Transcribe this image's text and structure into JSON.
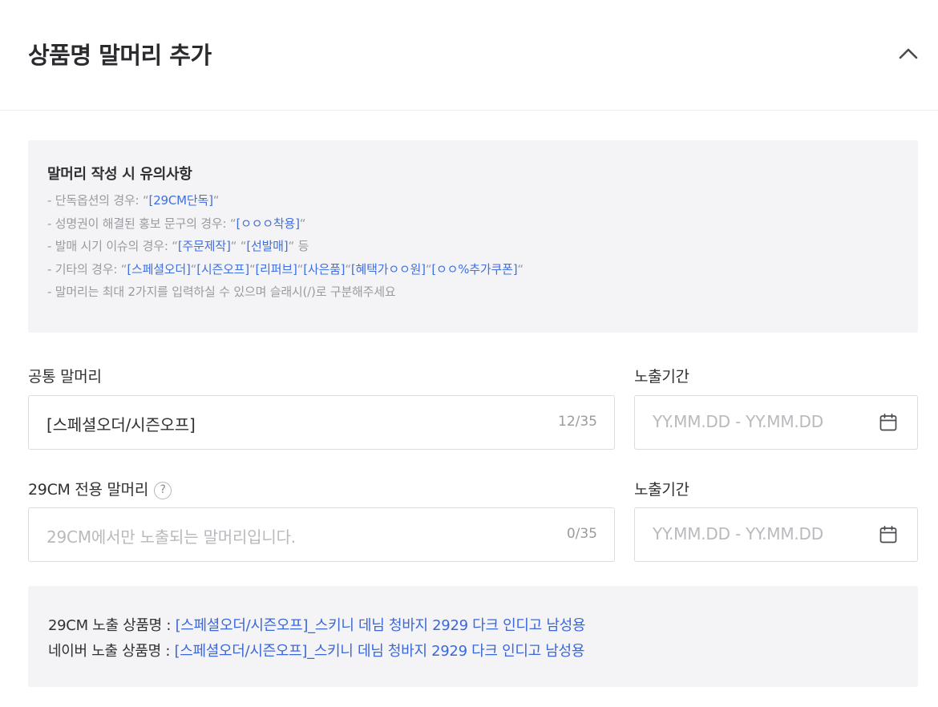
{
  "section": {
    "title": "상품명 말머리 추가"
  },
  "notice": {
    "title": "말머리 작성 시 유의사항",
    "lines": [
      {
        "prefix": "- 단독옵션의 경우: “",
        "parts": [
          "[29CM단독]"
        ],
        "suffix": "“"
      },
      {
        "prefix": "- 성명권이 해결된 홍보 문구의 경우: “",
        "parts": [
          "[ㅇㅇㅇ착용]"
        ],
        "suffix": "“"
      },
      {
        "prefix": "- 발매 시기 이슈의 경우: “",
        "parts": [
          "[주문제작]",
          "[선발매]"
        ],
        "separator": "“ “",
        "suffix": "“ 등"
      },
      {
        "prefix": "- 기타의 경우: “",
        "parts": [
          "[스페셜오더]",
          "[시즌오프]",
          "[리퍼브]",
          "[사은품]",
          "[혜택가ㅇㅇ원]",
          "[ㅇㅇ%추가쿠폰]"
        ],
        "separator": "“",
        "suffix": "“"
      },
      {
        "prefix": "- 말머리는 최대 2가지를 입력하실 수 있으며 슬래시(/)로 구분해주세요",
        "parts": [],
        "suffix": ""
      }
    ]
  },
  "common": {
    "label": "공통 말머리",
    "value": "[스페셜오더/시즌오프]",
    "counter": "12/35",
    "period_label": "노출기간",
    "period_placeholder": "YY.MM.DD - YY.MM.DD",
    "calendar_icon": "calendar-icon"
  },
  "exclusive": {
    "label": "29CM 전용 말머리",
    "help_glyph": "?",
    "placeholder": "29CM에서만 노출되는 말머리입니다.",
    "counter": "0/35",
    "period_label": "노출기간",
    "period_placeholder": "YY.MM.DD - YY.MM.DD",
    "calendar_icon": "calendar-icon"
  },
  "preview": {
    "cm_label": "29CM 노출 상품명 : ",
    "cm_value": "[스페셜오더/시즌오프]_스키니 데님 청바지 2929 다크 인디고 남성용",
    "naver_label": "네이버 노출 상품명 : ",
    "naver_value": "[스페셜오더/시즌오프]_스키니 데님 청바지 2929 다크 인디고 남성용"
  },
  "colors": {
    "accent": "#3f6fe0",
    "box_bg": "#f4f4f6",
    "border": "#dcdce0"
  }
}
